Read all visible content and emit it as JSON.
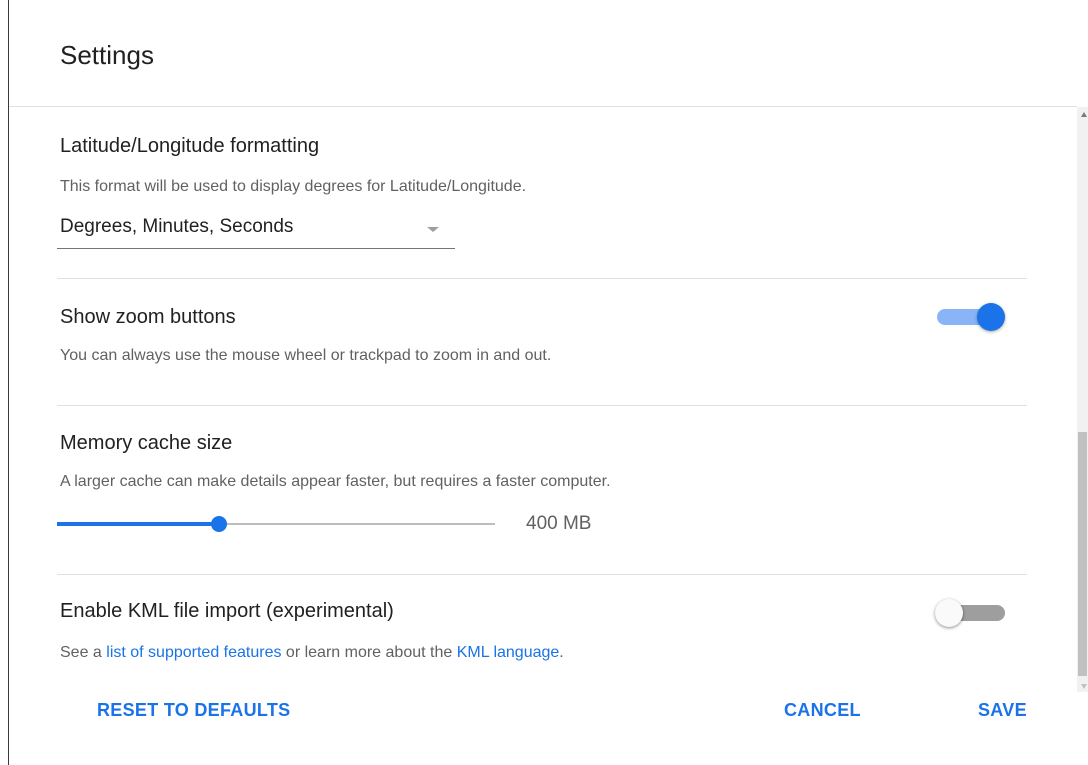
{
  "dialog": {
    "title": "Settings"
  },
  "settings": {
    "latlong": {
      "title": "Latitude/Longitude formatting",
      "description": "This format will be used to display degrees for Latitude/Longitude.",
      "selected_value": "Degrees, Minutes, Seconds"
    },
    "zoom_buttons": {
      "title": "Show zoom buttons",
      "description": "You can always use the mouse wheel or trackpad to zoom in and out.",
      "enabled": true
    },
    "memory_cache": {
      "title": "Memory cache size",
      "description": "A larger cache can make details appear faster, but requires a faster computer.",
      "value_label": "400 MB",
      "level_fraction": 0.37
    },
    "kml_import": {
      "title": "Enable KML file import (experimental)",
      "desc_prefix": "See a ",
      "link1": "list of supported features",
      "desc_middle": " or learn more about the ",
      "link2": "KML language",
      "desc_suffix": ".",
      "enabled": false
    }
  },
  "footer": {
    "reset_label": "RESET TO DEFAULTS",
    "cancel_label": "CANCEL",
    "save_label": "SAVE"
  },
  "colors": {
    "accent": "#1a73e8",
    "accent_light": "#8ab4f8",
    "text_primary": "#212121",
    "text_secondary": "#616161",
    "divider": "#e0e0e0"
  }
}
